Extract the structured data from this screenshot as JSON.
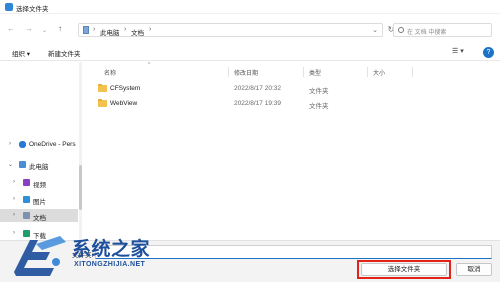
{
  "window": {
    "title": "选择文件夹"
  },
  "nav": {
    "back_icon": "arrow-left-icon",
    "forward_icon": "arrow-right-icon",
    "recent_icon": "chevron-down-icon",
    "up_icon": "arrow-up-icon",
    "breadcrumbs": [
      "此电脑",
      "文档"
    ],
    "refresh_icon": "refresh-icon",
    "search_placeholder": "在 文档 中搜索"
  },
  "toolbar": {
    "organize_label": "组织 ▾",
    "new_folder_label": "新建文件夹",
    "view_icon": "view-options-icon",
    "help_label": "?"
  },
  "sidebar": {
    "items": [
      {
        "label": "OneDrive - Pers",
        "icon": "cloud-icon",
        "color": "#2b78d4"
      },
      {
        "label": "此电脑",
        "icon": "computer-icon",
        "color": "#4a8fd6"
      },
      {
        "label": "视频",
        "icon": "video-icon",
        "color": "#8a3fc4"
      },
      {
        "label": "图片",
        "icon": "pictures-icon",
        "color": "#2f8fd8"
      },
      {
        "label": "文档",
        "icon": "documents-icon",
        "color": "#7d93ad"
      },
      {
        "label": "下载",
        "icon": "download-icon",
        "color": "#1e9e6a"
      }
    ]
  },
  "columns": {
    "name": "名称",
    "modified": "修改日期",
    "type": "类型",
    "size": "大小"
  },
  "files": [
    {
      "name": "CFSystem",
      "modified": "2022/8/17 20:32",
      "type": "文件夹"
    },
    {
      "name": "WebView",
      "modified": "2022/8/17 19:39",
      "type": "文件夹"
    }
  ],
  "footer": {
    "folder_label": "文件夹:",
    "folder_value": "",
    "select_label": "选择文件夹",
    "cancel_label": "取消"
  },
  "watermark": {
    "cn": "系统之家",
    "en": "XITONGZHIJIA.NET"
  },
  "colors": {
    "accent": "#1a73c9",
    "highlight": "#e2231a",
    "folder": "#f2c14e"
  }
}
